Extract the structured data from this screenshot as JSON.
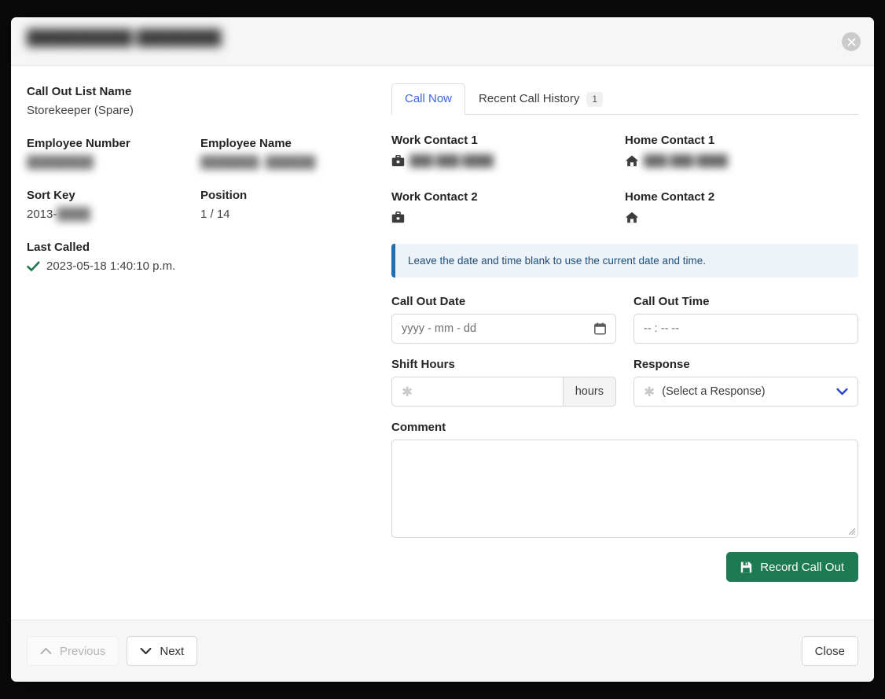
{
  "header": {
    "title_redacted": "██████████  ████████",
    "close_icon": "close-icon"
  },
  "details": {
    "call_out_list_name_label": "Call Out List Name",
    "call_out_list_name_value": "Storekeeper (Spare)",
    "employee_number_label": "Employee Number",
    "employee_number_value": "████████",
    "employee_name_label": "Employee Name",
    "employee_name_value": "███████, ██████",
    "sort_key_label": "Sort Key",
    "sort_key_prefix": "2013-",
    "sort_key_redacted": "████",
    "position_label": "Position",
    "position_value": "1 / 14",
    "last_called_label": "Last Called",
    "last_called_value": "2023-05-18 1:40:10 p.m.",
    "last_called_status_icon": "green-check-icon"
  },
  "tabs": [
    {
      "label": "Call Now",
      "active": true,
      "badge": null
    },
    {
      "label": "Recent Call History",
      "active": false,
      "badge": "1"
    }
  ],
  "contacts": [
    {
      "label": "Work Contact 1",
      "icon": "briefcase-icon",
      "value": "███ ███ ████"
    },
    {
      "label": "Home Contact 1",
      "icon": "house-icon",
      "value": "███ ███ ████"
    },
    {
      "label": "Work Contact 2",
      "icon": "briefcase-icon",
      "value": ""
    },
    {
      "label": "Home Contact 2",
      "icon": "house-icon",
      "value": ""
    }
  ],
  "alert": {
    "text": "Leave the date and time blank to use the current date and time.",
    "accent_color": "#2d6ca2",
    "background_color": "#eef3fa"
  },
  "form": {
    "call_out_date_label": "Call Out Date",
    "call_out_date_placeholder": "yyyy - mm - dd",
    "call_out_date_value": "",
    "call_out_date_icon": "calendar-icon",
    "call_out_time_label": "Call Out Time",
    "call_out_time_placeholder": "-- : --  --",
    "call_out_time_value": "",
    "shift_hours_label": "Shift Hours",
    "shift_hours_value": "",
    "shift_hours_required_marker": "✱",
    "shift_hours_addon": "hours",
    "response_label": "Response",
    "response_required_marker": "✱",
    "response_selected": "(Select a Response)",
    "response_icon": "chevron-down-icon",
    "comment_label": "Comment",
    "comment_value": "",
    "record_button_label": "Record Call Out",
    "record_button_icon": "save-icon",
    "record_button_color": "#1d7a52"
  },
  "footer": {
    "previous_label": "Previous",
    "previous_icon": "chevron-up-icon",
    "previous_disabled": true,
    "next_label": "Next",
    "next_icon": "chevron-down-icon",
    "close_label": "Close"
  }
}
